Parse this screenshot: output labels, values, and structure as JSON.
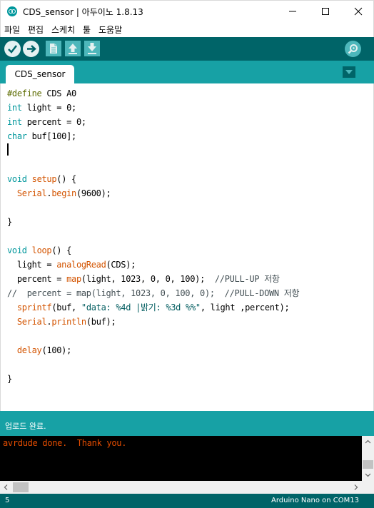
{
  "window": {
    "title": "CDS_sensor | 아두이노 1.8.13"
  },
  "menu": {
    "file": "파일",
    "edit": "편집",
    "sketch": "스케치",
    "tools": "툴",
    "help": "도움말"
  },
  "toolbar": {
    "icons": [
      "check-icon",
      "arrow-right-icon",
      "new-file-icon",
      "upload-arrow-icon",
      "download-arrow-icon",
      "magnifier-icon"
    ]
  },
  "tabs": [
    {
      "label": "CDS_sensor",
      "active": true
    }
  ],
  "editor": {
    "lines": [
      "#define CDS A0",
      "int light = 0;",
      "int percent = 0;",
      "char buf[100];",
      "",
      "",
      "void setup() {",
      "  Serial.begin(9600);",
      "",
      "}",
      "",
      "void loop() {",
      "  light = analogRead(CDS);",
      "  percent = map(light, 1023, 0, 0, 100);  //PULL-UP 저항",
      "//  percent = map(light, 1023, 0, 100, 0);  //PULL-DOWN 저항",
      "  sprintf(buf, \"data: %4d |밝기: %3d %%\", light ,percent);",
      "  Serial.println(buf);",
      "",
      "  delay(100);",
      "",
      "}"
    ]
  },
  "status": {
    "message": "업로드 완료."
  },
  "console": {
    "text": "avrdude done.  Thank you."
  },
  "footer": {
    "line_number": "5",
    "board": "Arduino Nano on COM13"
  },
  "colors": {
    "toolbar_dark": "#006468",
    "teal": "#17a1a5",
    "keyword_type": "#00979c",
    "keyword_function": "#d35400",
    "console_text": "#e34c00"
  }
}
